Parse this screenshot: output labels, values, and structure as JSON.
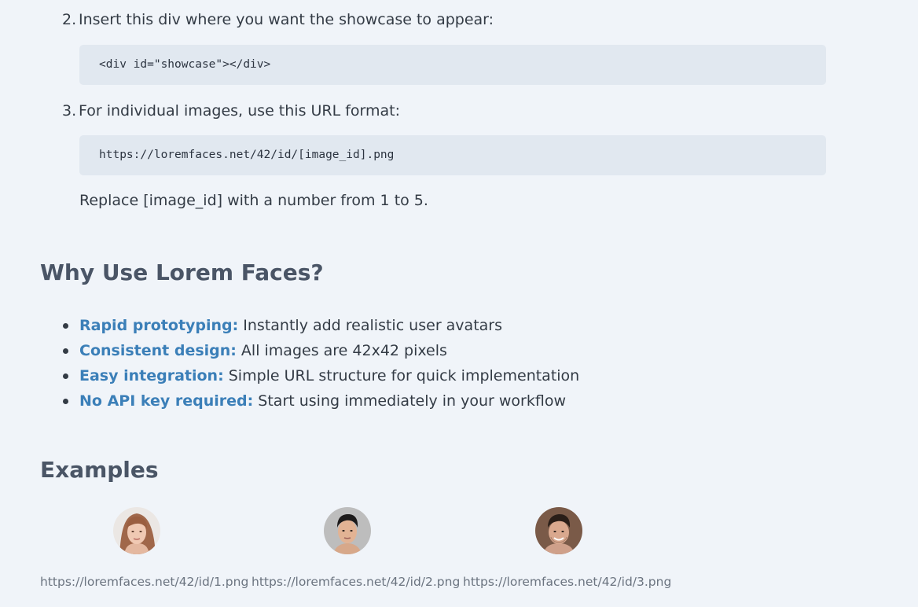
{
  "steps": [
    {
      "num": "2.",
      "text": "Insert this div where you want the showcase to appear:",
      "code": "<div id=\"showcase\"></div>"
    },
    {
      "num": "3.",
      "text": "For individual images, use this URL format:",
      "code": "https://loremfaces.net/42/id/[image_id].png"
    }
  ],
  "note": "Replace [image_id] with a number from 1 to 5.",
  "why": {
    "heading": "Why Use Lorem Faces?",
    "items": [
      {
        "key": "Rapid prototyping:",
        "text": " Instantly add realistic user avatars"
      },
      {
        "key": "Consistent design:",
        "text": " All images are 42x42 pixels"
      },
      {
        "key": "Easy integration:",
        "text": " Simple URL structure for quick implementation"
      },
      {
        "key": "No API key required:",
        "text": " Start using immediately in your workflow"
      }
    ]
  },
  "examples": {
    "heading": "Examples",
    "items": [
      {
        "url": "https://loremfaces.net/42/id/1.png",
        "icon": "woman-face-avatar"
      },
      {
        "url": "https://loremfaces.net/42/id/2.png",
        "icon": "young-man-face-avatar"
      },
      {
        "url": "https://loremfaces.net/42/id/3.png",
        "icon": "man-face-avatar"
      }
    ]
  },
  "colors": {
    "background": "#f0f4f9",
    "code_background": "#e1e8f0",
    "link": "#3b7fb8",
    "heading": "#4a5566",
    "caption": "#6b7480"
  }
}
